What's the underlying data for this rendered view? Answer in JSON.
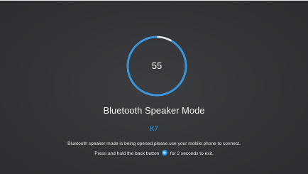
{
  "countdown": {
    "value": "55",
    "progress": 0.917
  },
  "mode": {
    "title": "Bluetooth Speaker Mode",
    "device_name": "K7"
  },
  "messages": {
    "status": "Bluetooth speaker mode is being opened,please use your mobile phone to connect.",
    "exit_prefix": "Press and hold the back button",
    "exit_suffix": "for 2 seconds to exit."
  },
  "colors": {
    "background": "#323437",
    "accent": "#2f96e6",
    "ring_remaining": "#e8e8e8",
    "text": "#f2f2f2"
  },
  "icons": {
    "back": "back-arrow-icon"
  }
}
